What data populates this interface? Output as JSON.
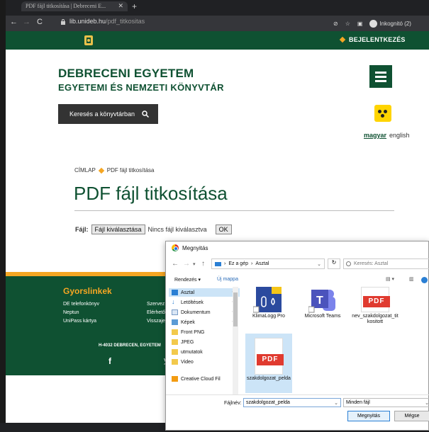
{
  "browser": {
    "tab_title": "PDF fájl titkosítása | Debreceni E...",
    "url_domain": "lib.unideb.hu",
    "url_path": "/pdf_titkositas",
    "incognito_label": "Inkognitó (2)"
  },
  "site": {
    "login_label": "BEJELENTKEZÉS",
    "university": "DEBRECENI EGYETEM",
    "library": "EGYETEMI ÉS NEMZETI KÖNYVTÁR",
    "search_label": "Keresés a könyvtárban",
    "lang_active": "magyar",
    "lang_other": "english"
  },
  "breadcrumb": {
    "home": "CÍMLAP",
    "current": "PDF fájl titkosítása"
  },
  "page": {
    "title": "PDF fájl titkosítása",
    "file_label": "Fájl:",
    "choose_button": "Fájl kiválasztása",
    "no_file": "Nincs fájl kiválasztva",
    "ok_button": "OK"
  },
  "footer": {
    "quick_title": "Gyorslinkek",
    "col1": [
      "DE telefonkönyv",
      "Neptun",
      "UniPass kártya"
    ],
    "col2": [
      "Szervez",
      "Elérhető",
      "Visszaje"
    ],
    "address": "H-4032 DEBRECEN, EGYETEM"
  },
  "dialog": {
    "title": "Megnyitás",
    "path_root": "Ez a gép",
    "path_leaf": "Asztal",
    "search_placeholder": "Keresés: Asztal",
    "organize": "Rendezés ▾",
    "new_folder": "Új mappa",
    "sidebar": [
      "Asztal",
      "Letöltések",
      "Dokumentum",
      "Képek",
      "Front PNG",
      "JPEG",
      "utmutatok",
      "Video",
      "Creative Cloud Fil"
    ],
    "files": [
      "KlimaLogg Pro",
      "Microsoft Teams",
      "nev_szakdolgozat_titkositott",
      "szakdolgozat_pelda"
    ],
    "filename_label": "Fájlnév:",
    "filename_value": "szakdolgozat_pelda",
    "filter_value": "Minden fájl",
    "open_button": "Megnyitás",
    "cancel_button": "Mégse"
  }
}
